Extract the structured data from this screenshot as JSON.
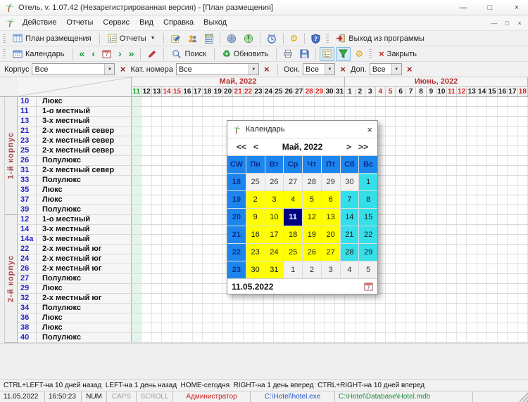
{
  "window": {
    "title": "Отель, v. 1.07.42 (Незарегистрированная версия) - [План размещения]",
    "controls": {
      "minimize": "—",
      "maximize": "□",
      "close": "×"
    }
  },
  "mdi": {
    "minimize": "—",
    "restore": "□",
    "close": "×"
  },
  "menu": {
    "items": [
      "Действие",
      "Отчеты",
      "Сервис",
      "Вид",
      "Справка",
      "Выход"
    ]
  },
  "toolbar1": {
    "plan_label": "План размещения",
    "reports_label": "Отчеты",
    "exit_label": "Выход из программы"
  },
  "toolbar2": {
    "calendar_label": "Календарь",
    "search_label": "Поиск",
    "refresh_label": "Обновить",
    "close_label": "Закрыть"
  },
  "icons": {
    "gear": "⚙",
    "refresh": "♻",
    "chevron_prev10": "«",
    "chevron_prev": "‹",
    "chevron_next": "›",
    "chevron_next10": "»",
    "close_x": "×",
    "dropdown_arrow": "▼",
    "named_svg": [
      "palm-tree-icon",
      "plan-grid-icon",
      "reports-icon",
      "edit-icon",
      "people-icon",
      "calculator-icon",
      "globe-icon",
      "globe-green-icon",
      "clock-icon",
      "shield-question-icon",
      "exit-icon",
      "calendar-icon",
      "calendar-day-icon",
      "marker-icon",
      "search-icon",
      "printer-icon",
      "save-icon",
      "legend-icon",
      "funnel-icon"
    ]
  },
  "filters": {
    "korpus_label": "Корпус",
    "korpus_value": "Все",
    "kat_label": "Кат. номера",
    "kat_value": "Все",
    "osn_label": "Осн.",
    "osn_value": "Все",
    "dop_label": "Доп.",
    "dop_value": "Все"
  },
  "grid": {
    "months": [
      {
        "label": "Май, 2022",
        "span": 21
      },
      {
        "label": "Июнь, 2022",
        "span": 18
      }
    ],
    "days": [
      [
        "11",
        "t"
      ],
      [
        "12",
        ""
      ],
      [
        "13",
        ""
      ],
      [
        "14",
        "r"
      ],
      [
        "15",
        "r"
      ],
      [
        "16",
        ""
      ],
      [
        "17",
        ""
      ],
      [
        "18",
        ""
      ],
      [
        "19",
        ""
      ],
      [
        "20",
        ""
      ],
      [
        "21",
        "r"
      ],
      [
        "22",
        "r"
      ],
      [
        "23",
        ""
      ],
      [
        "24",
        ""
      ],
      [
        "25",
        ""
      ],
      [
        "26",
        ""
      ],
      [
        "27",
        ""
      ],
      [
        "28",
        "r"
      ],
      [
        "29",
        "r"
      ],
      [
        "30",
        ""
      ],
      [
        "31",
        ""
      ],
      [
        "1",
        ""
      ],
      [
        "2",
        ""
      ],
      [
        "3",
        ""
      ],
      [
        "4",
        "r"
      ],
      [
        "5",
        "r"
      ],
      [
        "6",
        ""
      ],
      [
        "7",
        ""
      ],
      [
        "8",
        ""
      ],
      [
        "9",
        ""
      ],
      [
        "10",
        ""
      ],
      [
        "11",
        "r"
      ],
      [
        "12",
        "r"
      ],
      [
        "13",
        ""
      ],
      [
        "14",
        ""
      ],
      [
        "15",
        ""
      ],
      [
        "16",
        ""
      ],
      [
        "17",
        ""
      ],
      [
        "18",
        "r"
      ]
    ],
    "groups": [
      {
        "label": "1-й корпус",
        "rooms": [
          [
            "10",
            "Люкс"
          ],
          [
            "11",
            "1-о местный"
          ],
          [
            "13",
            "3-х местный"
          ],
          [
            "21",
            "2-х местный север"
          ],
          [
            "23",
            "2-х местный север"
          ],
          [
            "25",
            "2-х местный север"
          ],
          [
            "26",
            "Полулюкс"
          ],
          [
            "31",
            "2-х местный север"
          ],
          [
            "33",
            "Полулюкс"
          ],
          [
            "35",
            "Люкс"
          ],
          [
            "37",
            "Люкс"
          ],
          [
            "39",
            "Полулюкс"
          ]
        ]
      },
      {
        "label": "2-й корпус",
        "rooms": [
          [
            "12",
            "1-о местный"
          ],
          [
            "14",
            "3-х местный"
          ],
          [
            "14а",
            "3-х местный"
          ],
          [
            "22",
            "2-х местный юг"
          ],
          [
            "24",
            "2-х местный юг"
          ],
          [
            "26",
            "2-х местный юг"
          ],
          [
            "27",
            "Полулюкс"
          ],
          [
            "29",
            "Люкс"
          ],
          [
            "32",
            "2-х местный юг"
          ],
          [
            "34",
            "Полулюкс"
          ],
          [
            "36",
            "Люкс"
          ],
          [
            "38",
            "Люкс"
          ],
          [
            "40",
            "Полулюкс"
          ]
        ]
      }
    ]
  },
  "calendar_popup": {
    "title": "Календарь",
    "close": "×",
    "month_label": "Май, 2022",
    "nav": {
      "prev10": "<<",
      "prev": "<",
      "next": ">",
      "next10": ">>"
    },
    "weekday_headers": [
      "CW",
      "Пн",
      "Вт",
      "Ср",
      "Чт",
      "Пт",
      "Сб",
      "Вс"
    ],
    "weeks": [
      {
        "cw": "18",
        "cells": [
          [
            "25",
            "o"
          ],
          [
            "26",
            "o"
          ],
          [
            "27",
            "o"
          ],
          [
            "28",
            "o"
          ],
          [
            "29",
            "o"
          ],
          [
            "30",
            "o"
          ],
          [
            "1",
            "a"
          ]
        ]
      },
      {
        "cw": "19",
        "cells": [
          [
            "2",
            "y"
          ],
          [
            "3",
            "y"
          ],
          [
            "4",
            "y"
          ],
          [
            "5",
            "y"
          ],
          [
            "6",
            "y"
          ],
          [
            "7",
            "a"
          ],
          [
            "8",
            "a"
          ]
        ]
      },
      {
        "cw": "20",
        "cells": [
          [
            "9",
            "y"
          ],
          [
            "10",
            "y"
          ],
          [
            "11",
            "s"
          ],
          [
            "12",
            "y"
          ],
          [
            "13",
            "y"
          ],
          [
            "14",
            "a"
          ],
          [
            "15",
            "a"
          ]
        ]
      },
      {
        "cw": "21",
        "cells": [
          [
            "16",
            "y"
          ],
          [
            "17",
            "y"
          ],
          [
            "18",
            "y"
          ],
          [
            "19",
            "y"
          ],
          [
            "20",
            "y"
          ],
          [
            "21",
            "a"
          ],
          [
            "22",
            "a"
          ]
        ]
      },
      {
        "cw": "22",
        "cells": [
          [
            "23",
            "y"
          ],
          [
            "24",
            "y"
          ],
          [
            "25",
            "y"
          ],
          [
            "26",
            "y"
          ],
          [
            "27",
            "y"
          ],
          [
            "28",
            "a"
          ],
          [
            "29",
            "a"
          ]
        ]
      },
      {
        "cw": "23",
        "cells": [
          [
            "30",
            "y"
          ],
          [
            "31",
            "y"
          ],
          [
            "1",
            "o"
          ],
          [
            "2",
            "o"
          ],
          [
            "3",
            "o"
          ],
          [
            "4",
            "o"
          ],
          [
            "5",
            "o"
          ]
        ]
      }
    ],
    "selected_date": "11.05.2022"
  },
  "help_bar": {
    "text": "CTRL+LEFT-на 10 дней назад  LEFT-на 1 день назад  HOME-сегодня  RIGHT-на 1 день вперед  CTRL+RIGHT-на 10 дней вперед"
  },
  "status_bar": {
    "date": "11.05.2022",
    "time": "16:50:23",
    "num": "NUM",
    "caps": "CAPS",
    "scroll": "SCROLL",
    "user": "Администратор",
    "exe": "C:\\Hotel\\hotel.exe",
    "db": "C:\\Hotel\\Database\\Hotel.mdb"
  },
  "colors": {
    "cal_weekday_bg": "#ffff00",
    "cal_weekend_bg": "#35dfea",
    "cal_selected_bg": "#000080",
    "cal_cw_bg": "#1c86ee",
    "cal_other_month_bg": "#f1f1f1",
    "today_column": "#e2f5ea",
    "today_text": "#1f9d2f",
    "weekend_text": "#dd2222",
    "month_text": "#b23030",
    "room_number_text": "#2323cc",
    "building_text": "#a04040",
    "status_user": "#cc2222",
    "status_exe": "#2255cc",
    "status_db": "#1a8a3a"
  }
}
